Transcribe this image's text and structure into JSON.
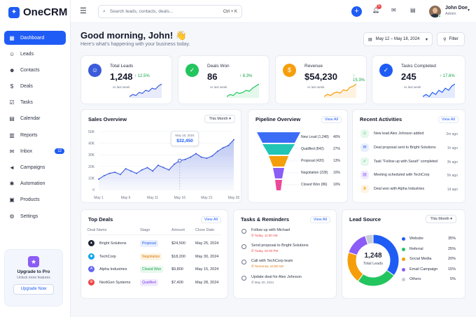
{
  "app": {
    "name": "OneCRM"
  },
  "sidebar": {
    "items": [
      {
        "label": "Dashboard",
        "icon": "grid-icon",
        "glyph": "▦"
      },
      {
        "label": "Leads",
        "icon": "user-icon",
        "glyph": "☺"
      },
      {
        "label": "Contacts",
        "icon": "users-icon",
        "glyph": "☻"
      },
      {
        "label": "Deals",
        "icon": "dollar-icon",
        "glyph": "$"
      },
      {
        "label": "Tasks",
        "icon": "tasks-icon",
        "glyph": "☑"
      },
      {
        "label": "Calendar",
        "icon": "calendar-icon",
        "glyph": "▤"
      },
      {
        "label": "Reports",
        "icon": "reports-icon",
        "glyph": "▥"
      },
      {
        "label": "Inbox",
        "icon": "inbox-icon",
        "glyph": "✉",
        "badge": "12"
      },
      {
        "label": "Campaigns",
        "icon": "megaphone-icon",
        "glyph": "◄"
      },
      {
        "label": "Automation",
        "icon": "automation-icon",
        "glyph": "✱"
      },
      {
        "label": "Products",
        "icon": "box-icon",
        "glyph": "▣"
      },
      {
        "label": "Settings",
        "icon": "gear-icon",
        "glyph": "⚙"
      }
    ],
    "upgrade": {
      "title": "Upgrade to Pro",
      "subtitle": "Unlock more features",
      "button": "Upgrade Now"
    }
  },
  "topbar": {
    "search_placeholder": "Search leads, contacts, deals...",
    "shortcut": "Ctrl + K",
    "notifications_count": "5",
    "user_name": "John Doe",
    "user_role": "Admin"
  },
  "header": {
    "greeting": "Good morning, John! 👋",
    "subtitle": "Here's what's happening with your business today.",
    "date_range": "May 12 – May 18, 2024",
    "filter_label": "Filter"
  },
  "stats": [
    {
      "label": "Total Leads",
      "value": "1,248",
      "change": "↑ 12.5%",
      "vs": "vs last week",
      "color": "#3b5bdb",
      "glyph": "☺",
      "spark": [
        3,
        4,
        3.5,
        5,
        4.5,
        6,
        5.5,
        7,
        6.5,
        8,
        9
      ]
    },
    {
      "label": "Deals Won",
      "value": "86",
      "change": "↑ 8.3%",
      "vs": "vs last week",
      "color": "#22c55e",
      "glyph": "✓",
      "spark": [
        2,
        3,
        2.5,
        4,
        3.5,
        4,
        5,
        4.5,
        6,
        7,
        8
      ]
    },
    {
      "label": "Revenue",
      "value": "$54,230",
      "change": "↑ 15.3%",
      "vs": "vs last week",
      "color": "#f59e0b",
      "glyph": "$",
      "spark": [
        3,
        4,
        3.5,
        4.5,
        5,
        4.5,
        6,
        5.5,
        7,
        7.5,
        8.5
      ]
    },
    {
      "label": "Tasks Completed",
      "value": "245",
      "change": "↑ 17.6%",
      "vs": "vs last week",
      "color": "#1f5cf5",
      "glyph": "✓",
      "spark": [
        3,
        4,
        3,
        5,
        4,
        6,
        5,
        7,
        6,
        8,
        9
      ]
    }
  ],
  "sales": {
    "title": "Sales Overview",
    "period": "This Month",
    "tooltip_date": "May 16, 2024",
    "tooltip_value": "$32,450"
  },
  "chart_data": {
    "type": "area",
    "title": "Sales Overview",
    "x": [
      "May 1",
      "May 2",
      "May 3",
      "May 4",
      "May 5",
      "May 6",
      "May 7",
      "May 8",
      "May 9",
      "May 10",
      "May 11",
      "May 12",
      "May 13",
      "May 14",
      "May 15",
      "May 16",
      "May 17",
      "May 18",
      "May 19",
      "May 20",
      "May 21",
      "May 22",
      "May 23",
      "May 24",
      "May 25",
      "May 26"
    ],
    "xticks": [
      "May 1",
      "May 6",
      "May 11",
      "May 16",
      "May 21",
      "May 26"
    ],
    "values": [
      9,
      12,
      14,
      15,
      13,
      18,
      16,
      14,
      17,
      19,
      16,
      21,
      19,
      17,
      22,
      25,
      26,
      28,
      31,
      28,
      27,
      29,
      33,
      36,
      38,
      43
    ],
    "yticks": [
      "0",
      "10K",
      "20K",
      "30K",
      "40K",
      "50K"
    ],
    "ylim": [
      0,
      50
    ],
    "color": "#3b5bdb"
  },
  "pipeline": {
    "title": "Pipeline Overview",
    "view_all": "View All",
    "stages": [
      {
        "label": "New Lead (1,248)",
        "pct": "40%",
        "color": "#3b6cf5"
      },
      {
        "label": "Qualified (842)",
        "pct": "27%",
        "color": "#22c5b5"
      },
      {
        "label": "Proposal (420)",
        "pct": "13%",
        "color": "#f59e0b"
      },
      {
        "label": "Negotiation (228)",
        "pct": "10%",
        "color": "#8b5cf6"
      },
      {
        "label": "Closed Won (86)",
        "pct": "10%",
        "color": "#ec4899"
      }
    ]
  },
  "activities": {
    "title": "Recent Activities",
    "view_all": "View All",
    "items": [
      {
        "text": "New lead Alex Johnson added",
        "time": "2m ago",
        "icon": "user-plus-icon",
        "glyph": "☺",
        "bg": "#e7f8ee",
        "fg": "#22c55e"
      },
      {
        "text": "Deal proposal sent to Bright Solutions",
        "time": "1h ago",
        "icon": "mail-icon",
        "glyph": "✉",
        "bg": "#e8effe",
        "fg": "#1f5cf5"
      },
      {
        "text": "Task \"Follow up with Sarah\" completed",
        "time": "3h ago",
        "icon": "check-icon",
        "glyph": "✓",
        "bg": "#e7f8ee",
        "fg": "#22c55e"
      },
      {
        "text": "Meeting scheduled with TechCorp",
        "time": "5h ago",
        "icon": "calendar-icon",
        "glyph": "▤",
        "bg": "#f1ebfe",
        "fg": "#8b5cf6"
      },
      {
        "text": "Deal won with Alpha Industries",
        "time": "1d ago",
        "icon": "trophy-icon",
        "glyph": "♛",
        "bg": "#fef5e6",
        "fg": "#f59e0b"
      }
    ]
  },
  "deals": {
    "title": "Top Deals",
    "view_all": "View All",
    "columns": [
      "Deal Name",
      "Stage",
      "Amount",
      "Close Date"
    ],
    "rows": [
      {
        "name": "Bright Solutions",
        "stage": "Proposal",
        "amount": "$24,500",
        "date": "May 25, 2024",
        "stage_bg": "#e8effe",
        "stage_fg": "#1f5cf5",
        "logo_bg": "#1e2433",
        "logo": "▲"
      },
      {
        "name": "TechCorp",
        "stage": "Negotiation",
        "amount": "$18,200",
        "date": "May 30, 2024",
        "stage_bg": "#fef3e2",
        "stage_fg": "#d97706",
        "logo_bg": "#0ea5e9",
        "logo": "◆"
      },
      {
        "name": "Alpha Industries",
        "stage": "Closed Won",
        "amount": "$9,800",
        "date": "May 15, 2024",
        "stage_bg": "#e7f8ee",
        "stage_fg": "#16a34a",
        "logo_bg": "#6366f1",
        "logo": "A"
      },
      {
        "name": "NextGen Systems",
        "stage": "Qualified",
        "amount": "$7,400",
        "date": "May 28, 2024",
        "stage_bg": "#f1ebfe",
        "stage_fg": "#7c3aed",
        "logo_bg": "#ef4444",
        "logo": "⚙"
      }
    ]
  },
  "tasks": {
    "title": "Tasks & Reminders",
    "view_all": "View All",
    "items": [
      {
        "text": "Follow up with Michael",
        "due": "⏱ Today, 11:00 AM",
        "color": "#ef4444"
      },
      {
        "text": "Send proposal to Bright Solutions",
        "due": "⏱ Today, 02:00 PM",
        "color": "#ef4444"
      },
      {
        "text": "Call with TechCorp team",
        "due": "⏱ Tomorrow, 10:00 AM",
        "color": "#d97706"
      },
      {
        "text": "Update deal for Alex Johnson",
        "due": "⏱ May 20, 2024",
        "color": "#6b7387"
      }
    ]
  },
  "lead_source": {
    "title": "Lead Source",
    "period": "This Month",
    "total": "1,248",
    "total_label": "Total Leads",
    "items": [
      {
        "label": "Website",
        "pct": "35%",
        "value": 35,
        "color": "#1f5cf5"
      },
      {
        "label": "Referral",
        "pct": "25%",
        "value": 25,
        "color": "#22c55e"
      },
      {
        "label": "Social Media",
        "pct": "20%",
        "value": 20,
        "color": "#f59e0b"
      },
      {
        "label": "Email Campaign",
        "pct": "15%",
        "value": 15,
        "color": "#8b5cf6"
      },
      {
        "label": "Others",
        "pct": "5%",
        "value": 5,
        "color": "#c7cdd8"
      }
    ]
  }
}
